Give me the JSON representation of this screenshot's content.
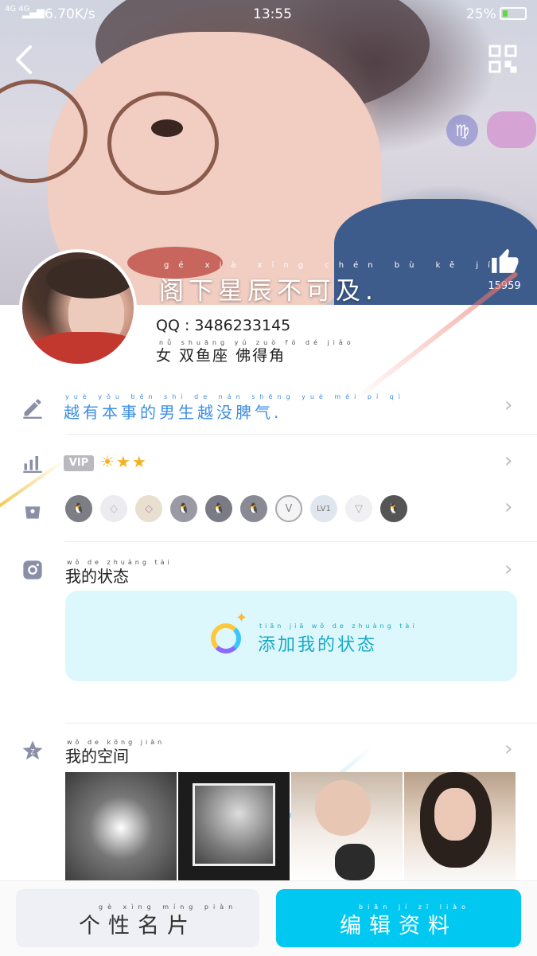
{
  "status_bar": {
    "network": "4G 4G",
    "speed": "6.70K/s",
    "time": "13:55",
    "battery": "25%"
  },
  "cover": {
    "title": "阁下星辰不可及.",
    "title_pinyin": "gé xià xīng chén bù kě jí",
    "like_count": "15959"
  },
  "profile": {
    "qq": "QQ : 3486233145",
    "info": "女 双鱼座 佛得角",
    "info_pinyin": "nǚ shuāng yú zuò fó dé jiǎo"
  },
  "signature": {
    "text": "越有本事的男生越没脾气.",
    "pinyin": "yuè yǒu běn shì de nán shēng yuè méi pí qì"
  },
  "vip": {
    "label": "VIP",
    "level": "☀★★"
  },
  "badges": [
    "🐧",
    "◇",
    "◇",
    "🐧",
    "🐧",
    "🐧",
    "V",
    "LV1",
    "▽",
    "🐧"
  ],
  "my_status": {
    "title": "我的状态",
    "title_pinyin": "wǒ de zhuàng tài",
    "add_label": "添加我的状态",
    "add_pinyin": "tiān jiā wǒ de zhuàng tài"
  },
  "my_space": {
    "title": "我的空间",
    "title_pinyin": "wǒ de kōng jiān"
  },
  "buttons": {
    "card": "个性名片",
    "card_pinyin": "gè xìng míng piàn",
    "edit": "编辑资料",
    "edit_pinyin": "biān jí zī liào"
  },
  "colors": {
    "accent": "#00c8f0",
    "status_bg": "#dcf8fc",
    "card_bg": "#eef0f5",
    "link": "#3d8ee6"
  }
}
